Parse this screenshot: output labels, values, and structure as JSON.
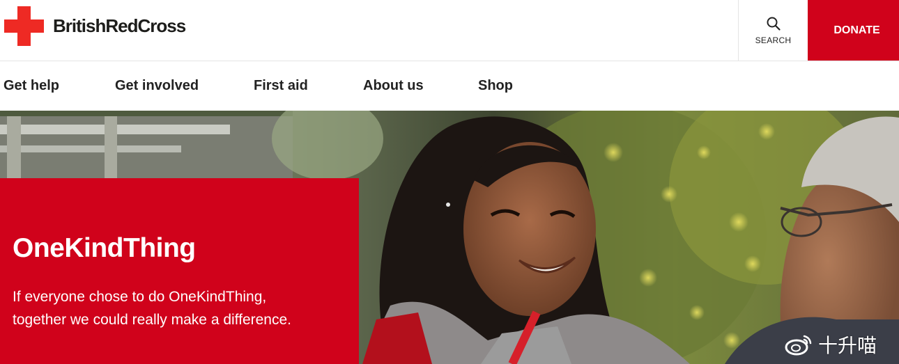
{
  "header": {
    "logo_text": "BritishRedCross",
    "search_label": "SEARCH",
    "donate_label": "DONATE"
  },
  "nav": {
    "items": [
      {
        "label": "Get help"
      },
      {
        "label": "Get involved"
      },
      {
        "label": "First aid"
      },
      {
        "label": "About us"
      },
      {
        "label": "Shop"
      }
    ]
  },
  "hero": {
    "title": "OneKindThing",
    "text": "If everyone chose to do OneKindThing, together we could really make a difference."
  },
  "watermark": {
    "text": "十升喵"
  },
  "colors": {
    "brand_red": "#d0021b",
    "logo_red": "#ee2a24"
  }
}
